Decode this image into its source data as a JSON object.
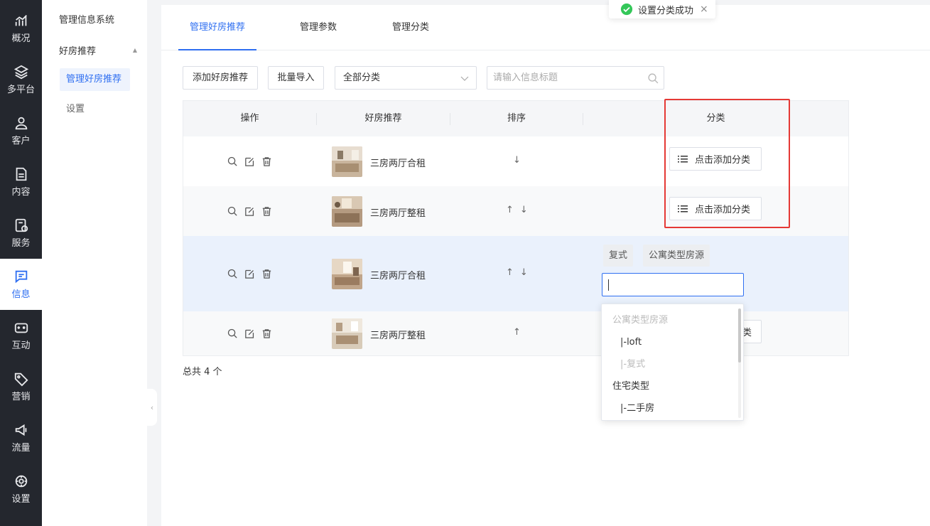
{
  "nav": {
    "items": [
      {
        "label": "概况",
        "icon": "chart-icon"
      },
      {
        "label": "多平台",
        "icon": "layers-icon"
      },
      {
        "label": "客户",
        "icon": "user-icon"
      },
      {
        "label": "内容",
        "icon": "document-icon"
      },
      {
        "label": "服务",
        "icon": "service-icon"
      },
      {
        "label": "信息",
        "icon": "message-icon",
        "active": true
      },
      {
        "label": "互动",
        "icon": "gamepad-icon"
      },
      {
        "label": "营销",
        "icon": "tag-icon"
      },
      {
        "label": "流量",
        "icon": "megaphone-icon"
      },
      {
        "label": "设置",
        "icon": "gear-icon"
      }
    ]
  },
  "sidebar": {
    "title": "管理信息系统",
    "group": "好房推荐",
    "items": [
      {
        "label": "管理好房推荐",
        "active": true
      },
      {
        "label": "设置"
      }
    ]
  },
  "tabs": [
    {
      "label": "管理好房推荐",
      "active": true
    },
    {
      "label": "管理参数"
    },
    {
      "label": "管理分类"
    }
  ],
  "toolbar": {
    "add_label": "添加好房推荐",
    "import_label": "批量导入",
    "category_select": "全部分类",
    "search_placeholder": "请输入信息标题"
  },
  "table": {
    "headers": [
      "操作",
      "好房推荐",
      "排序",
      "分类"
    ],
    "rows": [
      {
        "title": "三房两厅合租",
        "sort": [
          "↓"
        ],
        "category_button": "点击添加分类"
      },
      {
        "title": "三房两厅整租",
        "sort": [
          "↑",
          "↓"
        ],
        "category_button": "点击添加分类"
      },
      {
        "title": "三房两厅合租",
        "sort": [
          "↑",
          "↓"
        ],
        "tags": [
          "复式",
          "公寓类型房源"
        ]
      },
      {
        "title": "三房两厅整租",
        "sort": [
          "↑"
        ],
        "category_button": "类"
      }
    ],
    "total": "总共 4 个"
  },
  "dropdown": {
    "options": [
      {
        "label": "公寓类型房源",
        "disabled": true,
        "indent": false
      },
      {
        "label": "|-loft",
        "disabled": false,
        "indent": true
      },
      {
        "label": "|-复式",
        "disabled": true,
        "indent": true
      },
      {
        "label": "住宅类型",
        "disabled": false,
        "indent": false
      },
      {
        "label": "|-二手房",
        "disabled": false,
        "indent": true
      }
    ]
  },
  "toast": {
    "message": "设置分类成功",
    "close": "×"
  },
  "collapse_glyph": "‹",
  "colors": {
    "accent": "#2f6ff1",
    "nav_bg": "#24272e",
    "highlight": "#e53935",
    "success": "#34c759"
  }
}
